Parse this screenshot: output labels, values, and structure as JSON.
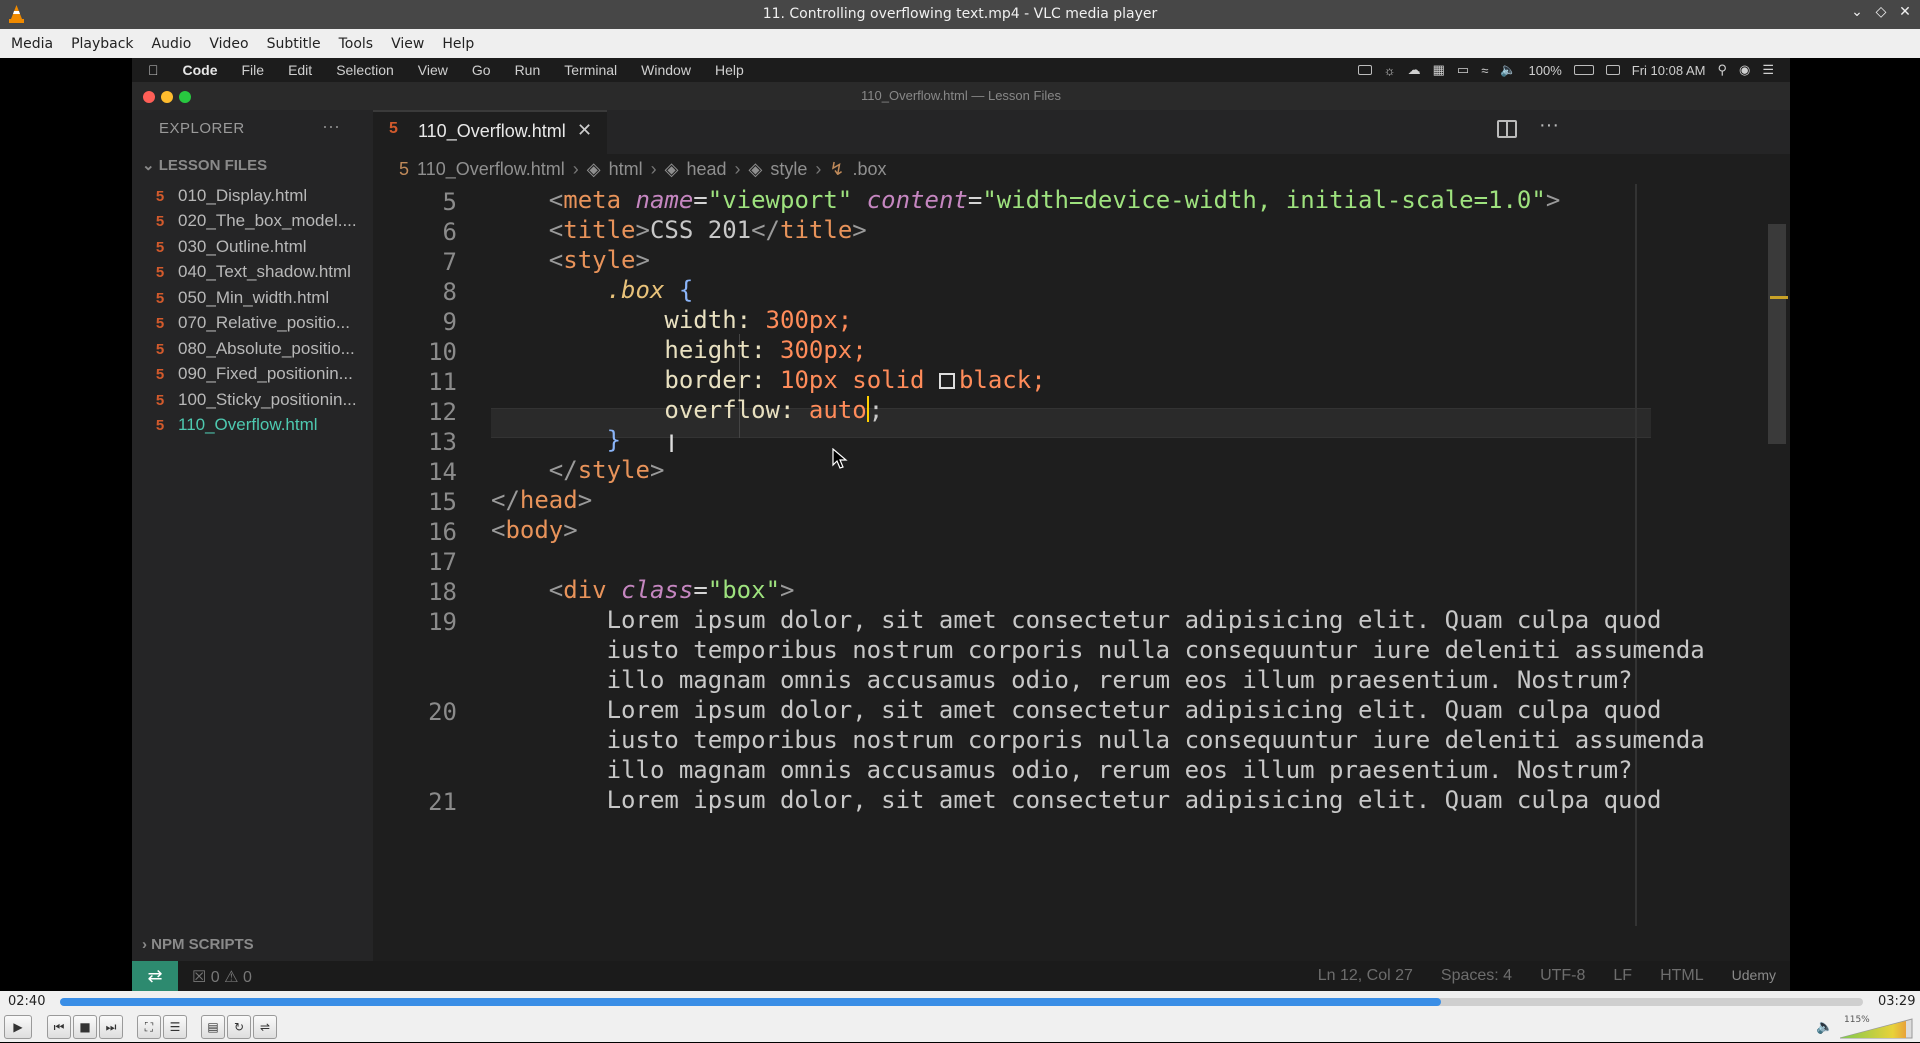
{
  "window": {
    "title": "11. Controlling overflowing text.mp4 - VLC media player"
  },
  "menubar": [
    "Media",
    "Playback",
    "Audio",
    "Video",
    "Subtitle",
    "Tools",
    "View",
    "Help"
  ],
  "video": {
    "mac_menu": [
      "Code",
      "File",
      "Edit",
      "Selection",
      "View",
      "Go",
      "Run",
      "Terminal",
      "Window",
      "Help"
    ],
    "mac_status": {
      "battery": "100%",
      "clock": "Fri 10:08 AM"
    },
    "window_title": "110_Overflow.html — Lesson Files",
    "explorer": {
      "header": "EXPLORER",
      "folder": "LESSON FILES",
      "files": [
        "010_Display.html",
        "020_The_box_model....",
        "030_Outline.html",
        "040_Text_shadow.html",
        "050_Min_width.html",
        "070_Relative_positio...",
        "080_Absolute_positio...",
        "090_Fixed_positionin...",
        "100_Sticky_positionin...",
        "110_Overflow.html"
      ],
      "npm": "NPM SCRIPTS"
    },
    "tab": {
      "label": "110_Overflow.html"
    },
    "breadcrumb": [
      "110_Overflow.html",
      "html",
      "head",
      "style",
      ".box"
    ],
    "line_numbers": [
      "5",
      "6",
      "7",
      "8",
      "9",
      "10",
      "11",
      "12",
      "13",
      "14",
      "15",
      "16",
      "17",
      "18",
      "19",
      "20",
      "21"
    ],
    "code": {
      "l5_attr1": "name",
      "l5_val1": "\"viewport\"",
      "l5_attr2": "content",
      "l5_val2": "\"width=device-width, initial-scale=1.0\"",
      "l6_text": "CSS 201",
      "l8_sel": ".box",
      "l9_prop": "width:",
      "l9_val": "300px;",
      "l10_prop": "height:",
      "l10_val": "300px;",
      "l11_prop": "border:",
      "l11_val": "10px solid",
      "l11_color": "black;",
      "l12_prop": "overflow:",
      "l12_val": "auto",
      "l18_attr": "class",
      "l18_val": "\"box\"",
      "lorem1": "Lorem ipsum dolor, sit amet consectetur adipisicing elit. Quam culpa quod",
      "lorem2": "iusto temporibus nostrum corporis nulla consequuntur iure deleniti assumenda",
      "lorem3": "illo magnam omnis accusamus odio, rerum eos illum praesentium. Nostrum?"
    },
    "status": {
      "problems": "0",
      "warnings": "0",
      "position": "Ln 12, Col 27",
      "spaces": "Spaces: 4",
      "encoding": "UTF-8",
      "eol": "LF",
      "language": "HTML",
      "brand": "Udemy"
    }
  },
  "player": {
    "elapsed": "02:40",
    "total": "03:29",
    "progress": 0.766,
    "volume": "115%",
    "accent": "#3a8ee6"
  }
}
